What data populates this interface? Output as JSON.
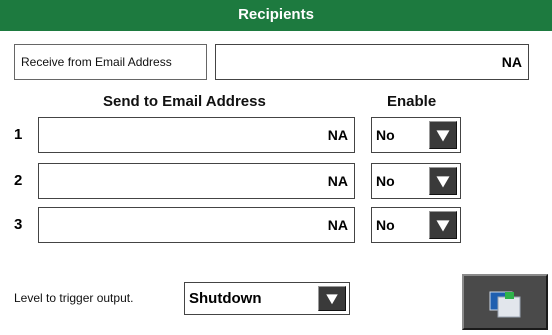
{
  "title": "Recipients",
  "receive_from": {
    "label": "Receive from Email Address",
    "value": "NA"
  },
  "headers": {
    "send_to": "Send to Email Address",
    "enable": "Enable"
  },
  "recipients": [
    {
      "num": "1",
      "email": "NA",
      "enable": "No"
    },
    {
      "num": "2",
      "email": "NA",
      "enable": "No"
    },
    {
      "num": "3",
      "email": "NA",
      "enable": "No"
    }
  ],
  "trigger": {
    "label": "Level to trigger output.",
    "value": "Shutdown"
  },
  "colors": {
    "titlebar": "#1d7a3f",
    "arrow_button": "#3a3a3a",
    "nav_button": "#4a4a4a"
  },
  "icons": {
    "dropdown": "triangle-down-icon",
    "nav": "screens-icon"
  }
}
